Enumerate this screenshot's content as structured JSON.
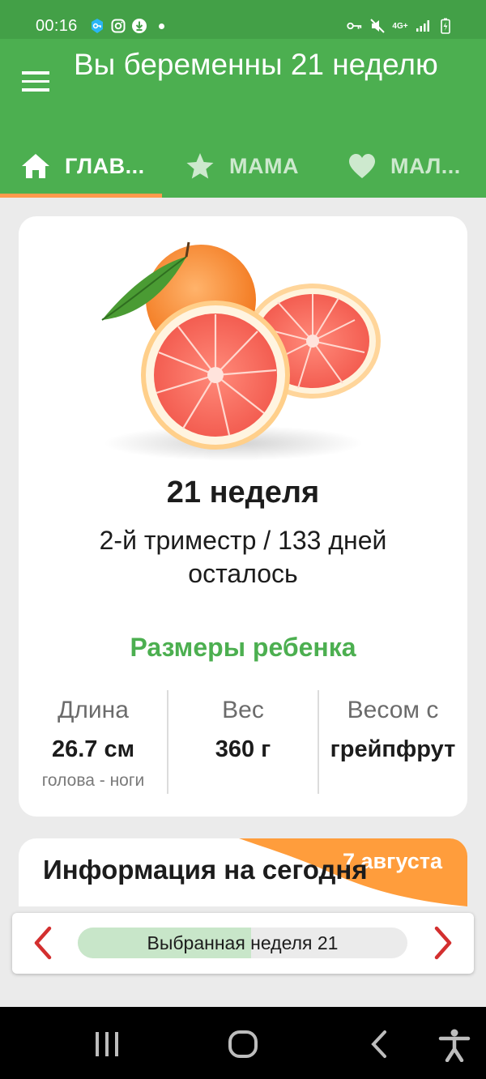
{
  "status_bar": {
    "time": "00:16",
    "network_label": "4G+",
    "icons_left": [
      "vpn-key-badge-icon",
      "instagram-icon",
      "download-icon",
      "dot-icon"
    ],
    "icons_right": [
      "key-icon",
      "mute-icon",
      "network-4g-icon",
      "signal-icon",
      "battery-charging-icon"
    ]
  },
  "app_bar": {
    "title": "Вы беременны 21 неделю",
    "menu_icon": "hamburger-menu-icon",
    "color": "#4caf50"
  },
  "tabs": [
    {
      "label": "ГЛАВ...",
      "icon": "home-icon",
      "active": true
    },
    {
      "label": "МАМА",
      "icon": "star-icon",
      "active": false
    },
    {
      "label": "МАЛ...",
      "icon": "heart-icon",
      "active": false
    }
  ],
  "tab_indicator_color": "#ff9a4d",
  "week_card": {
    "image": "grapefruit-image",
    "week_title": "21 неделя",
    "trimester_text": "2-й триместр / 133 дней осталось",
    "sizes_title": "Размеры ребенка",
    "stats": [
      {
        "label": "Длина",
        "value": "26.7 см",
        "sub": "голова - ноги"
      },
      {
        "label": "Вес",
        "value": "360 г",
        "sub": ""
      },
      {
        "label": "Весом с",
        "value": "грейпфрут",
        "sub": ""
      }
    ]
  },
  "info_card": {
    "title": "Информация на сегодня",
    "date": "7 августа"
  },
  "week_selector": {
    "label": "Выбранная неделя 21",
    "progress_fraction": 0.525,
    "prev_icon": "chevron-left-icon",
    "next_icon": "chevron-right-icon"
  },
  "nav_bar": {
    "buttons": [
      "recent-apps-icon",
      "home-circle-icon",
      "back-icon",
      "accessibility-icon"
    ]
  }
}
